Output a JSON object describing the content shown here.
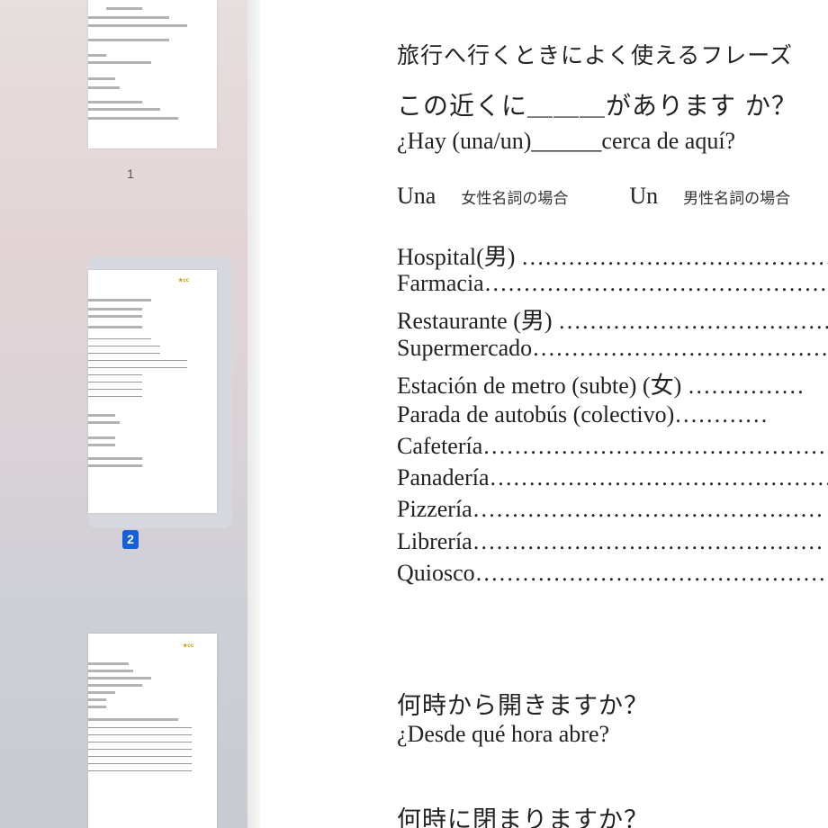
{
  "sidebar": {
    "pages": [
      {
        "label": "1"
      },
      {
        "label": "2"
      }
    ]
  },
  "document": {
    "title": "旅行へ行くときによく使えるフレーズ",
    "question1_jp": "この近くに＿＿＿があります か？",
    "question1_es": "¿Hay (una/un)______cerca de aquí?",
    "una_label": "Una",
    "una_note": "女性名詞の場合",
    "un_label": "Un",
    "un_note": "男性名詞の場合",
    "places": [
      "Hospital(男) …………………………………………",
      "Farmacia……………………………………………",
      "Restaurante (男) ……………………………………",
      "Supermercado…………………………………………",
      "Estación de metro (subte) (女) ……………",
      "Parada de autobús (colectivo)…………",
      "Cafetería……………………………………………",
      "Panadería……………………………………………",
      "Pizzería………………………………………",
      "Librería………………………………………",
      "Quiosco………………………………………"
    ],
    "question2_jp": "何時から開きますか？",
    "question2_es": "¿Desde qué hora abre?",
    "question3_jp": "何時に閉まりますか？"
  }
}
